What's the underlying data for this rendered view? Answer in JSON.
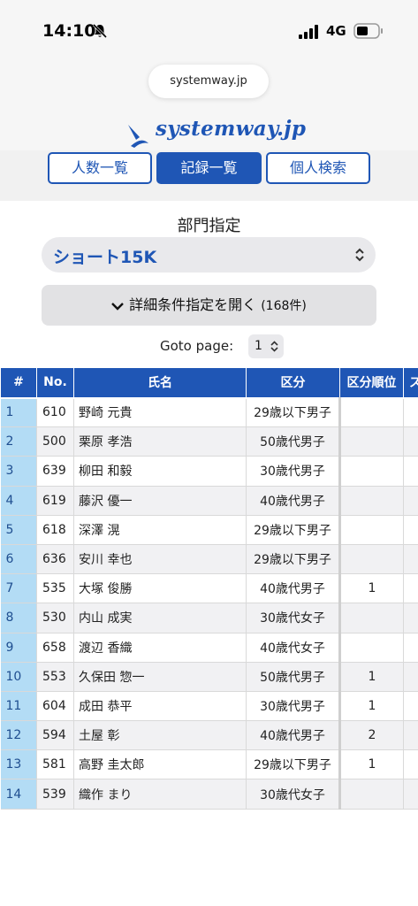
{
  "status_bar": {
    "time": "14:10",
    "network": "4G"
  },
  "browser": {
    "url": "systemway.jp"
  },
  "brand": {
    "name": "systemway.jp"
  },
  "nav": {
    "tabs": [
      {
        "label": "人数一覧"
      },
      {
        "label": "記録一覧"
      },
      {
        "label": "個人検索"
      }
    ]
  },
  "filters": {
    "section_label": "部門指定",
    "division": "ショート15K",
    "detail_toggle": "詳細条件指定を開く",
    "count": "(168件)",
    "goto_label": "Goto page:",
    "page": "1"
  },
  "colors": {
    "accent": "#1f56b5",
    "index_col": "#b3dcf5",
    "row_alt": "#f1f1f3"
  },
  "table": {
    "columns": [
      "#",
      "No.",
      "氏名",
      "区分",
      "区分順位",
      "ス"
    ],
    "rows": [
      {
        "idx": "1",
        "no": "610",
        "name": "野崎 元貴",
        "category": "29歳以下男子",
        "rank": ""
      },
      {
        "idx": "2",
        "no": "500",
        "name": "栗原 孝浩",
        "category": "50歳代男子",
        "rank": ""
      },
      {
        "idx": "3",
        "no": "639",
        "name": "柳田 和毅",
        "category": "30歳代男子",
        "rank": ""
      },
      {
        "idx": "4",
        "no": "619",
        "name": "藤沢 優一",
        "category": "40歳代男子",
        "rank": ""
      },
      {
        "idx": "5",
        "no": "618",
        "name": "深澤 滉",
        "category": "29歳以下男子",
        "rank": ""
      },
      {
        "idx": "6",
        "no": "636",
        "name": "安川 幸也",
        "category": "29歳以下男子",
        "rank": ""
      },
      {
        "idx": "7",
        "no": "535",
        "name": "大塚 俊勝",
        "category": "40歳代男子",
        "rank": "1"
      },
      {
        "idx": "8",
        "no": "530",
        "name": "内山 成実",
        "category": "30歳代女子",
        "rank": ""
      },
      {
        "idx": "9",
        "no": "658",
        "name": "渡辺 香織",
        "category": "40歳代女子",
        "rank": ""
      },
      {
        "idx": "10",
        "no": "553",
        "name": "久保田 惣一",
        "category": "50歳代男子",
        "rank": "1"
      },
      {
        "idx": "11",
        "no": "604",
        "name": "成田 恭平",
        "category": "30歳代男子",
        "rank": "1"
      },
      {
        "idx": "12",
        "no": "594",
        "name": "土屋 彰",
        "category": "40歳代男子",
        "rank": "2"
      },
      {
        "idx": "13",
        "no": "581",
        "name": "高野 圭太郎",
        "category": "29歳以下男子",
        "rank": "1"
      },
      {
        "idx": "14",
        "no": "539",
        "name": "織作 まり",
        "category": "30歳代女子",
        "rank": ""
      }
    ]
  }
}
